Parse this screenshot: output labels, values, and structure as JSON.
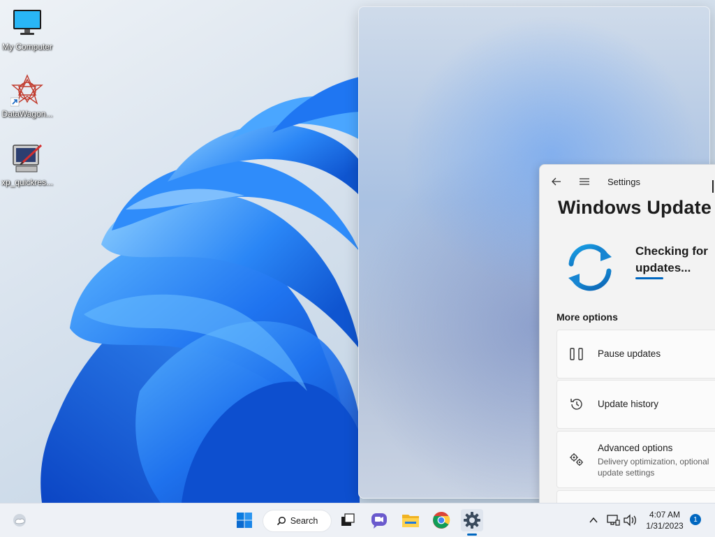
{
  "desktop": {
    "icons": [
      {
        "label": "My Computer",
        "icon": "monitor-icon"
      },
      {
        "label": "DataWagon...",
        "icon": "datawagon-icon"
      },
      {
        "label": "xp_quickres...",
        "icon": "quickres-icon"
      }
    ]
  },
  "settings": {
    "window_title": "Settings",
    "page_title": "Windows Update",
    "status": "Checking for updates...",
    "more_options_heading": "More options",
    "options": [
      {
        "title": "Pause updates",
        "subtitle": "",
        "icon": "pause-icon"
      },
      {
        "title": "Update history",
        "subtitle": "",
        "icon": "history-icon"
      },
      {
        "title": "Advanced options",
        "subtitle": "Delivery optimization, optional update settings",
        "icon": "gears-icon"
      }
    ]
  },
  "taskbar": {
    "search_label": "Search",
    "time": "4:07 AM",
    "date": "1/31/2023",
    "notification_count": "1"
  },
  "colors": {
    "accent": "#0067c0",
    "bloom": "#1a6ef2"
  }
}
